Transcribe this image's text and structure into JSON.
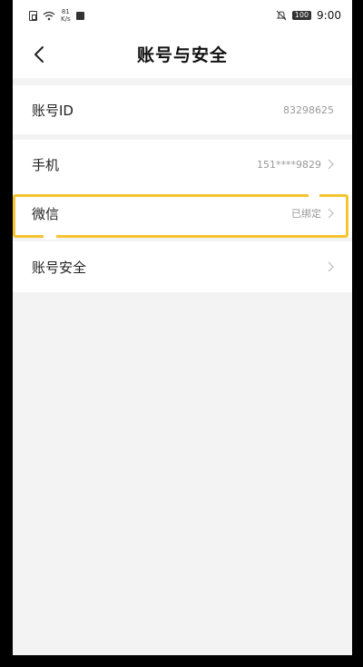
{
  "status_bar": {
    "net_speed_value": "81",
    "net_speed_unit": "K/s",
    "battery": "100",
    "time": "9:00"
  },
  "header": {
    "title": "账号与安全"
  },
  "rows": {
    "account_id": {
      "label": "账号ID",
      "value": "83298625"
    },
    "phone": {
      "label": "手机",
      "value": "151****9829"
    },
    "wechat": {
      "label": "微信",
      "value": "已绑定"
    },
    "security": {
      "label": "账号安全"
    }
  },
  "colors": {
    "highlight": "#f6c431",
    "background": "#f3f3f3"
  },
  "icons": [
    "sim-icon",
    "wifi-icon",
    "notification-square-icon",
    "mute-bell-icon",
    "battery-icon",
    "back-arrow-icon",
    "chevron-right-icon"
  ]
}
